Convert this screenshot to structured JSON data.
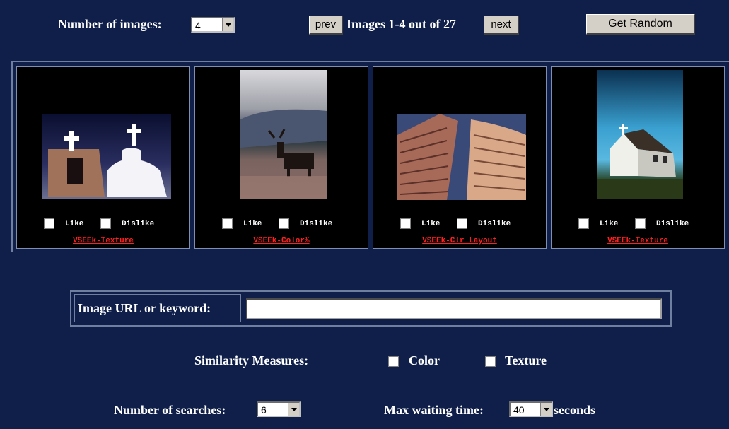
{
  "header": {
    "num_images_label": "Number of images:",
    "num_images_value": "4",
    "prev_label": "prev",
    "range_text": "Images 1-4 out of 27",
    "next_label": "next",
    "random_label": "Get Random"
  },
  "gallery": [
    {
      "like": "Like",
      "dislike": "Dislike",
      "algorithm": "VSEEk-Texture",
      "subject": "adobe church bell towers with crosses"
    },
    {
      "like": "Like",
      "dislike": "Dislike",
      "algorithm": "VSEEk-Color%",
      "subject": "elk in mountain meadow"
    },
    {
      "like": "Like",
      "dislike": "Dislike",
      "algorithm": "VSEEk-Clr Layout",
      "subject": "skyscrapers looking up"
    },
    {
      "like": "Like",
      "dislike": "Dislike",
      "algorithm": "VSEEk-Texture",
      "subject": "white chapel under blue sky"
    }
  ],
  "search": {
    "url_label": "Image URL or keyword:",
    "url_value": ""
  },
  "similarity": {
    "label": "Similarity Measures:",
    "options": [
      "Color",
      "Texture"
    ]
  },
  "footer": {
    "num_searches_label": "Number of searches:",
    "num_searches_value": "6",
    "max_wait_label": "Max waiting time:",
    "max_wait_value": "40",
    "seconds_label": "seconds"
  },
  "colors": {
    "background": "#0f1f4a",
    "link": "#ff2020"
  }
}
